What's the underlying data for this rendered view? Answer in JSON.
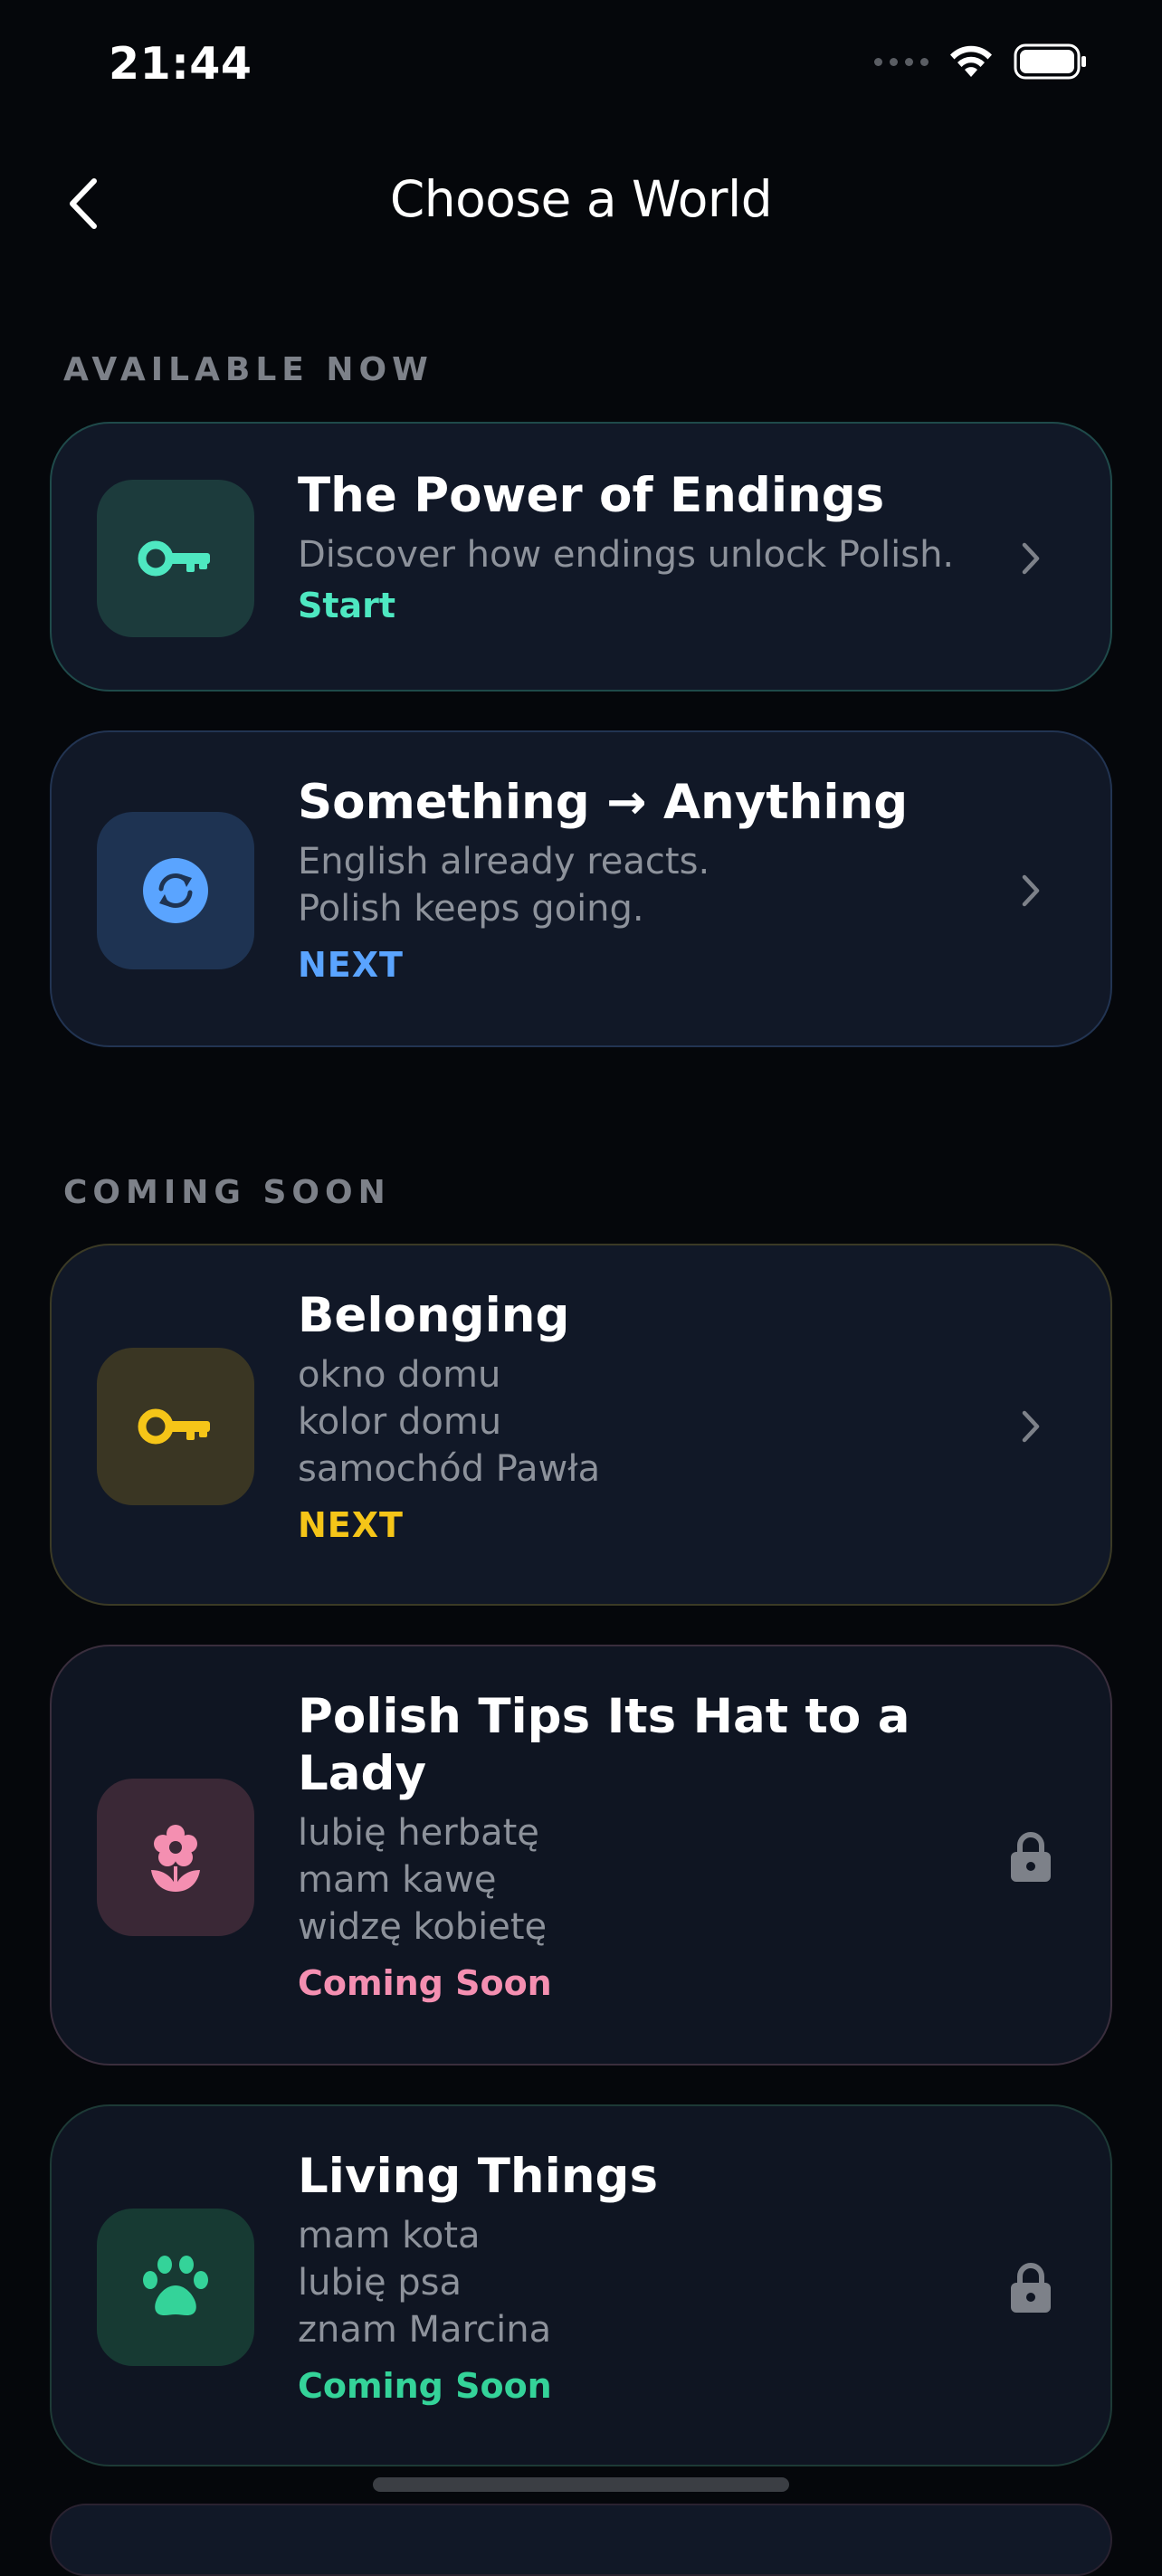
{
  "status_bar": {
    "time": "21:44"
  },
  "nav": {
    "title": "Choose a World"
  },
  "sections": {
    "available_header": "AVAILABLE NOW",
    "coming_header": "COMING SOON"
  },
  "cards": [
    {
      "title": "The Power of Endings",
      "lines": [
        "Discover how endings unlock Polish."
      ],
      "status": "Start",
      "icon": "key-icon",
      "accent": "#4ee8c1",
      "trailing": "chevron-right-icon"
    },
    {
      "title": "Something → Anything",
      "lines": [
        "English already reacts.",
        "Polish keeps going."
      ],
      "status": "NEXT",
      "icon": "sync-icon",
      "accent": "#5aa4ff",
      "trailing": "chevron-right-icon"
    },
    {
      "title": "Belonging",
      "lines": [
        "okno domu",
        "kolor domu",
        "samochód Pawła"
      ],
      "status": "NEXT",
      "icon": "key-icon",
      "accent": "#f5c518",
      "trailing": "chevron-right-icon"
    },
    {
      "title": "Polish Tips Its Hat to a Lady",
      "lines": [
        "lubię herbatę",
        "mam kawę",
        "widzę kobietę"
      ],
      "status": "Coming Soon",
      "icon": "flower-icon",
      "accent": "#f48fb1",
      "trailing": "lock-icon"
    },
    {
      "title": "Living Things",
      "lines": [
        "mam kota",
        "lubię psa",
        "znam Marcina"
      ],
      "status": "Coming Soon",
      "icon": "paw-icon",
      "accent": "#34d399",
      "trailing": "lock-icon"
    }
  ]
}
